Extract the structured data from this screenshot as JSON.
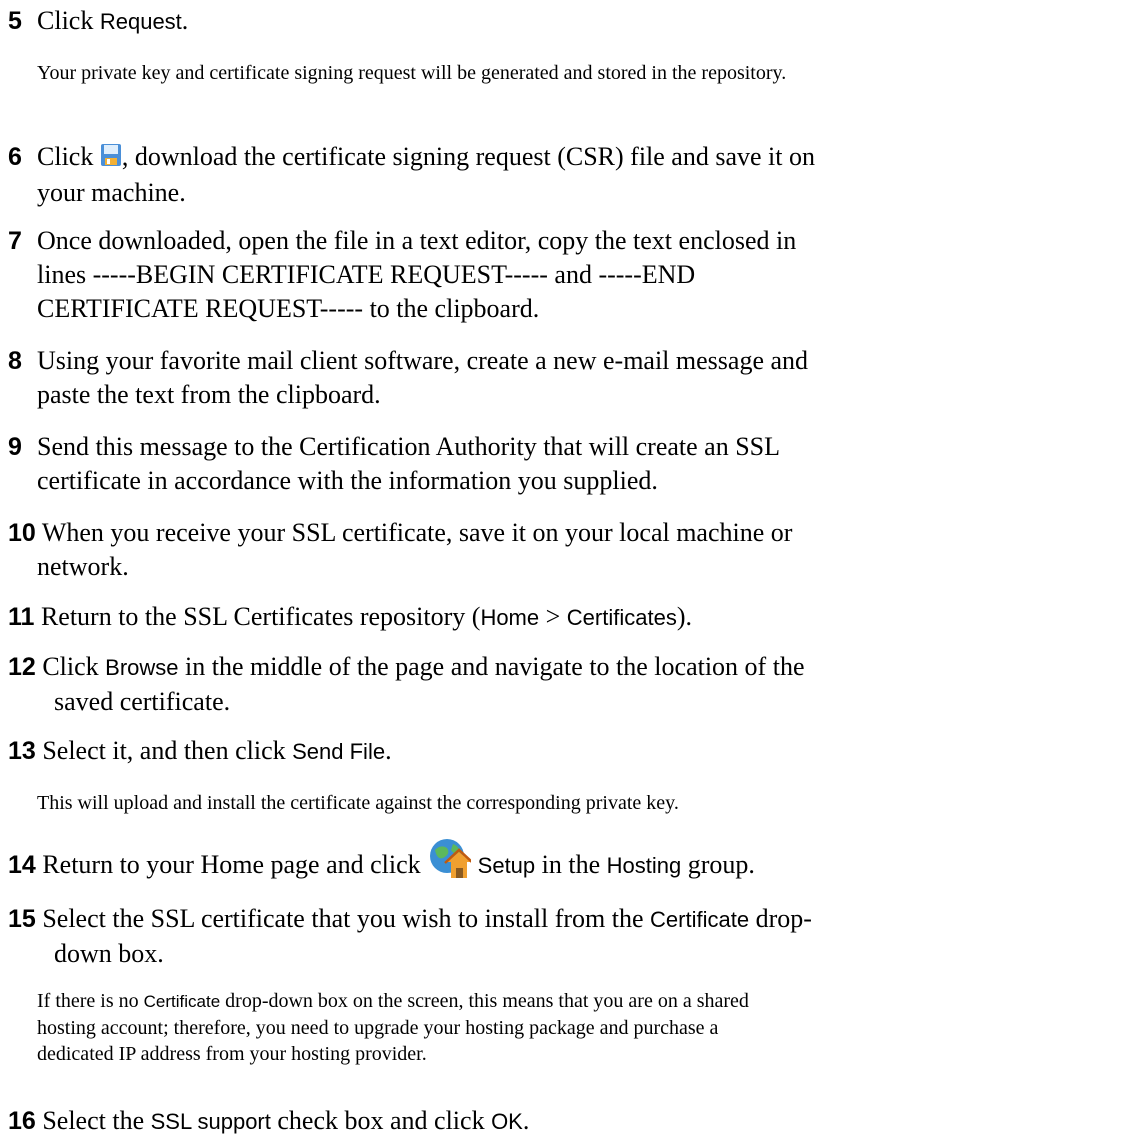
{
  "steps": {
    "s5": {
      "num": "5",
      "pre": "Click ",
      "ui": "Request",
      "post": "."
    },
    "note5": "Your private key and certificate signing request will be generated and stored in the repository.",
    "s6": {
      "num": "6",
      "pre": "Click ",
      "post": ", download the certificate signing request (CSR) file and save it on",
      "cont": "your machine.",
      "icon": "save-disk-icon"
    },
    "s7": {
      "num": "7",
      "l1": "Once downloaded, open the file in a text editor, copy the text enclosed in",
      "l2": "lines -----BEGIN CERTIFICATE REQUEST----- and -----END",
      "l3": "CERTIFICATE REQUEST----- to the clipboard."
    },
    "s8": {
      "num": "8",
      "l1": "Using your favorite mail client software, create a new e-mail message and",
      "l2": "paste the text from the clipboard."
    },
    "s9": {
      "num": "9",
      "l1": "Send this message to the Certification Authority that will create an SSL",
      "l2": "certificate in accordance with the information you supplied."
    },
    "s10": {
      "num": "10",
      "l1": "When you receive your SSL certificate, save it on your local machine or",
      "l2": "network."
    },
    "s11": {
      "num": "11",
      "pre": "Return to the SSL Certificates repository (",
      "ui1": "Home",
      "mid": " > ",
      "ui2": "Certificates",
      "post": ")."
    },
    "s12": {
      "num": "12",
      "pre": "Click ",
      "ui": "Browse",
      "post": " in the middle of the page and navigate to the location of the",
      "l2": "saved certificate."
    },
    "s13": {
      "num": "13",
      "pre": "Select it, and then click ",
      "ui": "Send File",
      "post": "."
    },
    "note13": "This will upload and install the certificate against the corresponding private key.",
    "s14": {
      "num": "14",
      "pre": "Return to your Home page and click ",
      "ui1": "Setup",
      "mid": " in the ",
      "ui2": "Hosting",
      "post": " group.",
      "icon": "hosting-setup-icon"
    },
    "s15": {
      "num": "15",
      "pre": "Select the SSL certificate that you wish to install from the ",
      "ui": "Certificate",
      "post": " drop-",
      "l2": "down box."
    },
    "note15": {
      "pre": "If there is no ",
      "ui": "Certificate",
      "l1post": " drop-down box on the screen, this means that you are on a shared",
      "l2": "hosting account; therefore, you need to upgrade your hosting package and purchase a",
      "l3": "dedicated IP address from your hosting provider."
    },
    "s16": {
      "num": "16",
      "pre": "Select the ",
      "ui1": "SSL support",
      "mid": " check box and click ",
      "ui2": "OK",
      "post": "."
    }
  }
}
